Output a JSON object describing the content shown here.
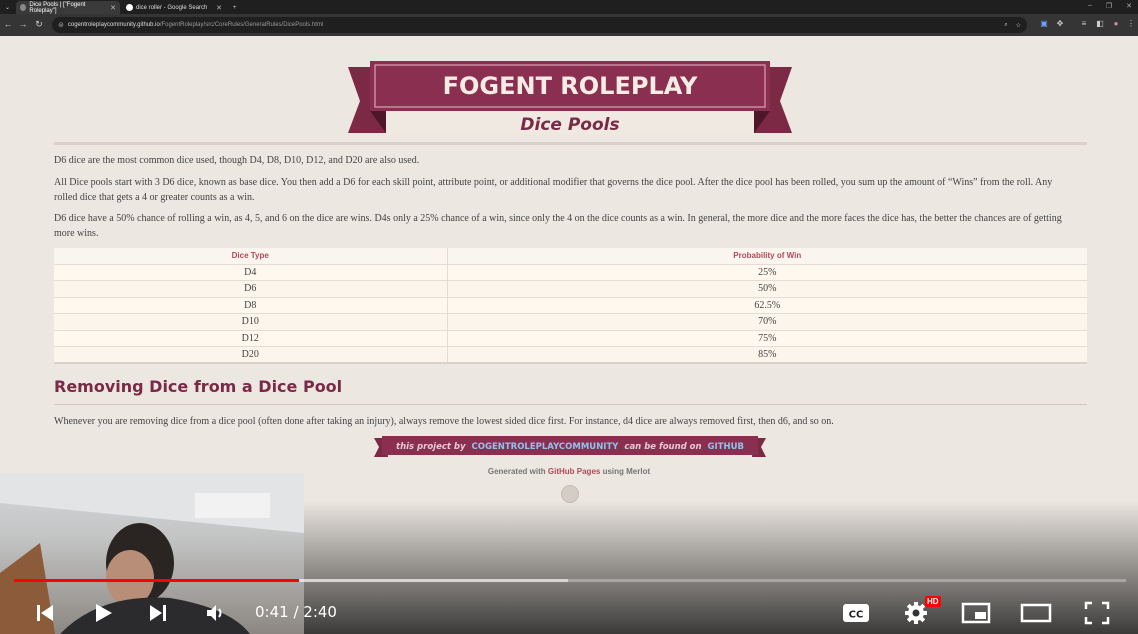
{
  "browser": {
    "tabs": [
      {
        "title": "Dice Pools | [\"Fogent Roleplay\"]",
        "active": true
      },
      {
        "title": "dice roller - Google Search",
        "active": false
      }
    ],
    "new_tab": "+",
    "url_host": "cogentroleplaycommunity.github.io",
    "url_path": "/FogentRoleplay/src/CoreRules/GeneralRules/DicePools.html"
  },
  "page": {
    "site_title": "FOGENT ROLEPLAY",
    "page_title": "Dice Pools",
    "paragraphs": [
      "D6 dice are the most common dice used, though D4, D8, D10, D12, and D20 are also used.",
      "All Dice pools start with 3 D6 dice, known as base dice. You then add a D6 for each skill point, attribute point, or additional modifier that governs the dice pool. After the dice pool has been rolled, you sum up the amount of “Wins” from the roll. Any rolled dice that gets a 4 or greater counts as a win.",
      "D6 dice have a 50% chance of rolling a win, as 4, 5, and 6 on the dice are wins. D4s only a 25% chance of a win, since only the 4 on the dice counts as a win. In general, the more dice and the more faces the dice has, the better the chances are of getting more wins."
    ],
    "table": {
      "headers": [
        "Dice Type",
        "Probability of Win"
      ],
      "rows": [
        [
          "D4",
          "25%"
        ],
        [
          "D6",
          "50%"
        ],
        [
          "D8",
          "62.5%"
        ],
        [
          "D10",
          "70%"
        ],
        [
          "D12",
          "75%"
        ],
        [
          "D20",
          "85%"
        ]
      ]
    },
    "section_heading": "Removing Dice from a Dice Pool",
    "section_paragraph": "Whenever you are removing dice from a dice pool (often done after taking an injury), always remove the lowest sided dice first. For instance, d4 dice are always removed first, then d6, and so on.",
    "footer_banner": {
      "prefix": "this project by",
      "owner": "COGENTROLEPLAYCOMMUNITY",
      "middle": "can be found on",
      "host": "GITHUB"
    },
    "generated": {
      "prefix": "Generated with",
      "link": "GitHub Pages",
      "suffix": "using Merlot"
    }
  },
  "player": {
    "current_time": "0:41",
    "separator": " / ",
    "duration": "2:40",
    "played_fraction": 0.256,
    "buffered_fraction": 0.498,
    "hd_badge": "HD",
    "cc_label": "CC"
  },
  "colors": {
    "banner": "#8b2f50",
    "banner_dark": "#5e1d36",
    "accent": "#b04a5a",
    "heading": "#7a2a46",
    "progress": "#ff0000"
  },
  "icons": [
    "previous-icon",
    "play-icon",
    "next-icon",
    "volume-icon",
    "settings-icon",
    "miniplayer-icon",
    "theater-icon",
    "fullscreen-icon",
    "github-icon"
  ]
}
